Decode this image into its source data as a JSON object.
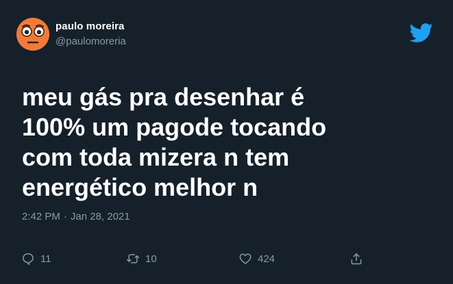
{
  "user": {
    "name": "paulo moreira",
    "handle": "@paulomoreria"
  },
  "tweet": {
    "text": "meu gás pra desenhar é\n100% um pagode tocando\ncom toda mizera n tem\nenergético melhor n",
    "time": "2:42 PM",
    "separator": "·",
    "date": "Jan 28, 2021"
  },
  "actions": {
    "replies": "11",
    "retweets": "10",
    "likes": "424"
  },
  "icons": {
    "avatar": "flushed-face-emoji",
    "logo": "twitter-bird-icon",
    "reply": "reply-icon",
    "retweet": "retweet-icon",
    "like": "heart-icon",
    "share": "share-icon"
  },
  "colors": {
    "background": "#15202b",
    "text": "#ffffff",
    "secondary": "#8899a6",
    "twitter_blue": "#1da1f2",
    "avatar": "#f07a3a"
  }
}
